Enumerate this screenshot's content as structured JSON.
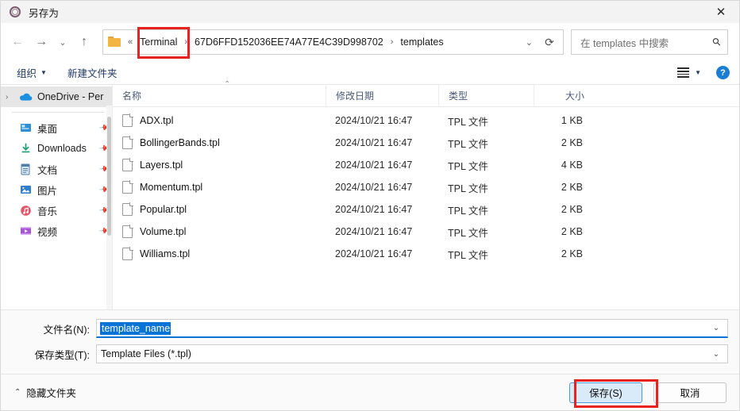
{
  "window": {
    "title": "另存为",
    "icon": "app-circle-icon",
    "close_label": "✕"
  },
  "nav": {
    "back": "←",
    "forward": "→",
    "recent": "⌄",
    "up": "↑",
    "refresh": "⟳",
    "path_chevron": "⌄",
    "folder_icon": "folder-icon",
    "breadcrumb_lead": "«",
    "breadcrumbs": [
      {
        "label": "Terminal",
        "highlighted": true
      },
      {
        "label": "67D6FFD152036EE74A77E4C39D998702",
        "highlighted": false
      },
      {
        "label": "templates",
        "highlighted": false
      }
    ],
    "separator": "›"
  },
  "search": {
    "placeholder": "在 templates 中搜索",
    "icon": "search-icon"
  },
  "toolbar": {
    "organize_label": "组织",
    "organize_caret": "▼",
    "new_folder_label": "新建文件夹",
    "view_caret": "▼",
    "help_label": "?"
  },
  "sidebar": {
    "items": [
      {
        "label": "OneDrive - Per",
        "icon": "onedrive-cloud-icon",
        "expander": "›",
        "pinned": false,
        "hovered": true
      },
      {
        "label": "桌面",
        "icon": "desktop-icon",
        "expander": "",
        "pinned": true,
        "hovered": false
      },
      {
        "label": "Downloads",
        "icon": "downloads-icon",
        "expander": "",
        "pinned": true,
        "hovered": false
      },
      {
        "label": "文档",
        "icon": "documents-icon",
        "expander": "",
        "pinned": true,
        "hovered": false
      },
      {
        "label": "图片",
        "icon": "pictures-icon",
        "expander": "",
        "pinned": true,
        "hovered": false
      },
      {
        "label": "音乐",
        "icon": "music-icon",
        "expander": "",
        "pinned": true,
        "hovered": false
      },
      {
        "label": "视频",
        "icon": "videos-icon",
        "expander": "",
        "pinned": true,
        "hovered": false
      }
    ],
    "pin_glyph": "📌"
  },
  "filelist": {
    "columns": {
      "name": "名称",
      "date": "修改日期",
      "type": "类型",
      "size": "大小"
    },
    "sort_caret": "⌃",
    "rows": [
      {
        "name": "ADX.tpl",
        "date": "2024/10/21 16:47",
        "type": "TPL 文件",
        "size": "1 KB"
      },
      {
        "name": "BollingerBands.tpl",
        "date": "2024/10/21 16:47",
        "type": "TPL 文件",
        "size": "2 KB"
      },
      {
        "name": "Layers.tpl",
        "date": "2024/10/21 16:47",
        "type": "TPL 文件",
        "size": "4 KB"
      },
      {
        "name": "Momentum.tpl",
        "date": "2024/10/21 16:47",
        "type": "TPL 文件",
        "size": "2 KB"
      },
      {
        "name": "Popular.tpl",
        "date": "2024/10/21 16:47",
        "type": "TPL 文件",
        "size": "2 KB"
      },
      {
        "name": "Volume.tpl",
        "date": "2024/10/21 16:47",
        "type": "TPL 文件",
        "size": "2 KB"
      },
      {
        "name": "Williams.tpl",
        "date": "2024/10/21 16:47",
        "type": "TPL 文件",
        "size": "2 KB"
      }
    ]
  },
  "form": {
    "filename_label": "文件名(N):",
    "filename_value": "template_name",
    "filetype_label": "保存类型(T):",
    "filetype_value": "Template Files (*.tpl)",
    "combo_caret": "⌄"
  },
  "footer": {
    "hide_folders_label": "隐藏文件夹",
    "hide_folders_caret": "⌃",
    "save_label": "保存(S)",
    "cancel_label": "取消"
  },
  "colors": {
    "accent": "#0a73d6",
    "annotation": "#e8221f",
    "folder": "#f2b544",
    "help": "#1a7fd4"
  }
}
